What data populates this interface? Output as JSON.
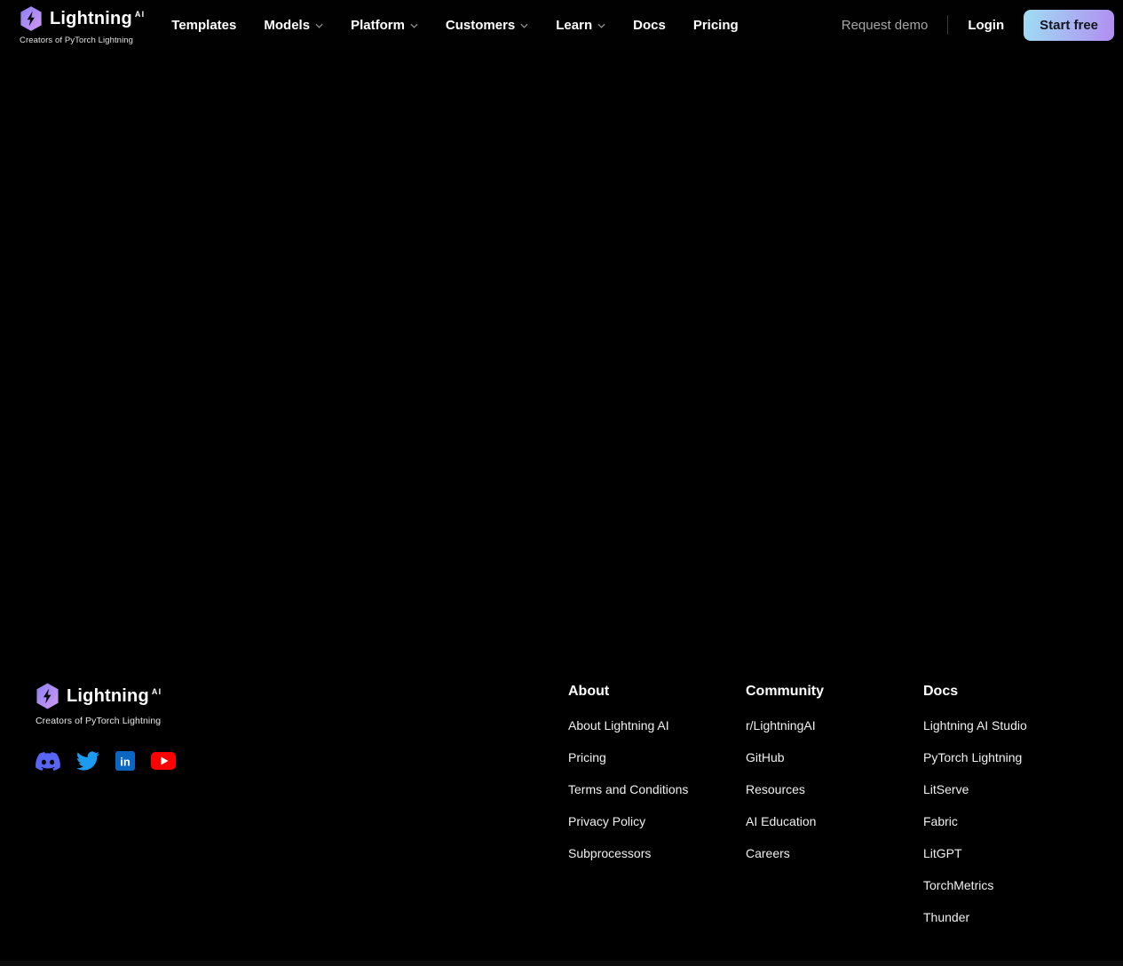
{
  "brand": {
    "name": "Lightning",
    "superscript": "AI",
    "tagline": "Creators of PyTorch Lightning"
  },
  "header": {
    "nav": [
      {
        "label": "Templates",
        "dropdown": false
      },
      {
        "label": "Models",
        "dropdown": true
      },
      {
        "label": "Platform",
        "dropdown": true
      },
      {
        "label": "Customers",
        "dropdown": true
      },
      {
        "label": "Learn",
        "dropdown": true
      },
      {
        "label": "Docs",
        "dropdown": false
      },
      {
        "label": "Pricing",
        "dropdown": false
      }
    ],
    "actions": {
      "request_demo": "Request demo",
      "login": "Login",
      "start_free": "Start free"
    }
  },
  "footer": {
    "social": [
      {
        "name": "Discord",
        "color": "#5865F2"
      },
      {
        "name": "Twitter",
        "color": "#1D9BF0"
      },
      {
        "name": "LinkedIn",
        "color": "#0A66C2"
      },
      {
        "name": "YouTube",
        "color": "#FF0000"
      }
    ],
    "columns": [
      {
        "title": "About",
        "links": [
          "About Lightning AI",
          "Pricing",
          "Terms and Conditions",
          "Privacy Policy",
          "Subprocessors"
        ]
      },
      {
        "title": "Community",
        "links": [
          "r/LightningAI",
          "GitHub",
          "Resources",
          "AI Education",
          "Careers"
        ]
      },
      {
        "title": "Docs",
        "links": [
          "Lightning AI Studio",
          "PyTorch Lightning",
          "LitServe",
          "Fabric",
          "LitGPT",
          "TorchMetrics",
          "Thunder"
        ]
      }
    ]
  },
  "colors": {
    "background": "#000000",
    "button_gradient_start": "#9EDEF2",
    "button_gradient_end": "#B18DF2",
    "button_text": "#15151E",
    "logo_gradient_start": "#8B7FF0",
    "logo_gradient_end": "#D19AF5",
    "muted_text": "#A6A6A6"
  }
}
